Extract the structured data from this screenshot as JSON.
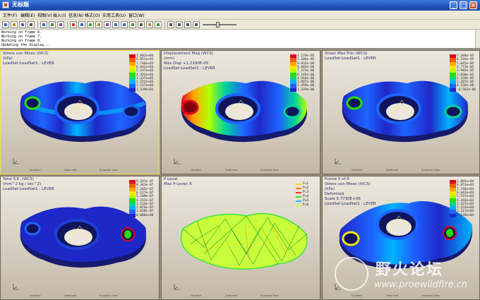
{
  "window": {
    "title": "无标题"
  },
  "menu": [
    "文件(F)",
    "编辑(E)",
    "视图(V)",
    "插入(I)",
    "信息(N)",
    "格式(O)",
    "实用工具(U)",
    "窗口(W)"
  ],
  "toolbar": {
    "icons": [
      "new-icon",
      "open-icon",
      "save-icon",
      "print-icon",
      "copy-icon",
      "paste-icon",
      "results-icon",
      "delete-icon",
      "edit-icon",
      "window-icon",
      "format-icon",
      "legend-icon",
      "zoom-in-icon",
      "zoom-out-icon",
      "refit-icon",
      "spin-icon",
      "capture-icon",
      "animate-icon",
      "play-icon",
      "stop-icon",
      "first-frame-icon",
      "last-frame-icon"
    ],
    "animation_position": 0.45
  },
  "log": [
    "Working on frame 6.",
    "Working on frame 7.",
    "Working on frame 8.",
    "Updating the display..."
  ],
  "panes": [
    {
      "lines": [
        "Stress von Mises (WCS)",
        "(kPa)",
        "LoadSet:LoadSet1 : LEVER"
      ],
      "legend": [
        "1.002e+04",
        "8.851e+03",
        "7.746e+03",
        "6.642e+03",
        "5.537e+03",
        "4.432e+03",
        "3.327e+03",
        "2.222e+03",
        "1.117e+03",
        "1.239e+01"
      ],
      "footer": [
        "\"Untitled\"",
        "Deformed",
        "Snapshot View"
      ]
    },
    {
      "lines": [
        "Displacement Mag (WCS)",
        "(mm)",
        "Max Disp  +1.2290E-05",
        "LoadSet:LoadSet1 : LEVER"
      ],
      "legend": [
        "1.229e-05",
        "1.106e-05",
        "9.832e-06",
        "8.603e-06",
        "7.374e-06",
        "6.145e-06",
        "4.916e-06",
        "3.687e-06",
        "2.458e-06",
        "1.229e-06"
      ],
      "footer": [
        "\"Untitled\"",
        "Deformed",
        "Snapshot View"
      ]
    },
    {
      "lines": [
        "Strain Max Prin (WCS)",
        "LoadSet:LoadSet1 : LEVER"
      ],
      "legend": [
        "7.388e-05",
        "6.516e-05",
        "5.645e-05",
        "4.773e-05",
        "3.902e-05",
        "3.030e-05",
        "2.159e-05",
        "1.287e-05",
        "4.156e-06",
        "-4.561e-06"
      ],
      "footer": [
        "\"Untitled\"",
        "Deformed",
        "Snapshot View"
      ]
    },
    {
      "lines": [
        "Total S.E. (WCS)",
        "(mm^2 kg / sec^2)",
        "LoadSet:LoadSet1 : LEVER"
      ],
      "legend": [
        "9.341e-07",
        "8.303e-07",
        "7.265e-07",
        "6.227e-07",
        "5.189e-07",
        "4.152e-07",
        "3.114e-07",
        "2.076e-07",
        "1.038e-07",
        "0.000e+00"
      ],
      "footer": [
        "\"Untitled\"",
        "Deformed",
        "Snapshot View"
      ]
    },
    {
      "lines": [
        "P-Level",
        "Max P-Level: 6"
      ],
      "legend": [
        "P=1",
        "P=2",
        "P=3",
        "P=4",
        "P=5",
        "P=6"
      ],
      "footer": [
        "\"Untitled\"",
        "Deformed",
        "Snapshot View"
      ]
    },
    {
      "lines": [
        "Frame 5 of 8",
        "Stress von Mises (WCS)",
        "(kPa)",
        "Deformed",
        "Scale   5.7730E+06",
        "LoadSet:LoadSet1 : LEVER"
      ],
      "legend": [
        "1.002e+04",
        "8.851e+03",
        "7.746e+03",
        "6.642e+03",
        "5.537e+03",
        "4.432e+03",
        "3.327e+03",
        "2.222e+03",
        "1.117e+03",
        "1.239e+01"
      ],
      "footer": [
        "\"Untitled\"",
        "Deformed",
        "Snapshot View"
      ]
    }
  ],
  "colors": {
    "scale": [
      "#e2001a",
      "#f25c00",
      "#ffa500",
      "#ffe600",
      "#b2ff00",
      "#22e000",
      "#00d29a",
      "#00b4ff",
      "#1e64ff",
      "#1e28c8"
    ],
    "plevel": [
      "#ffd400",
      "#ff7a00",
      "#ff3030",
      "#39e639",
      "#2ab8ff",
      "#c8ff3c"
    ]
  },
  "watermark": {
    "cn": "野火论坛",
    "url": "www.proewildfire.cn"
  }
}
